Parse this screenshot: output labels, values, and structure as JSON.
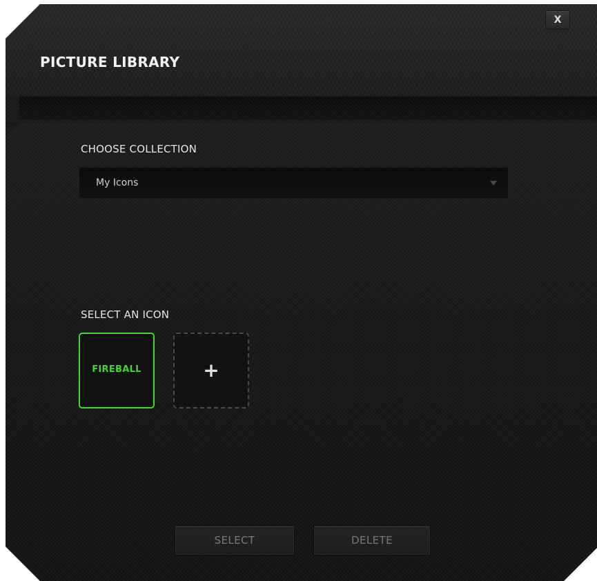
{
  "window": {
    "title": "PICTURE LIBRARY",
    "close_label": "X"
  },
  "collection": {
    "label": "CHOOSE COLLECTION",
    "selected": "My Icons"
  },
  "icons": {
    "label": "SELECT AN ICON",
    "items": [
      {
        "label": "FIREBALL",
        "selected": true
      },
      {
        "label": "+",
        "type": "add"
      }
    ]
  },
  "actions": {
    "select_label": "SELECT",
    "delete_label": "DELETE"
  },
  "colors": {
    "accent": "#44d62c",
    "background": "#151515"
  }
}
